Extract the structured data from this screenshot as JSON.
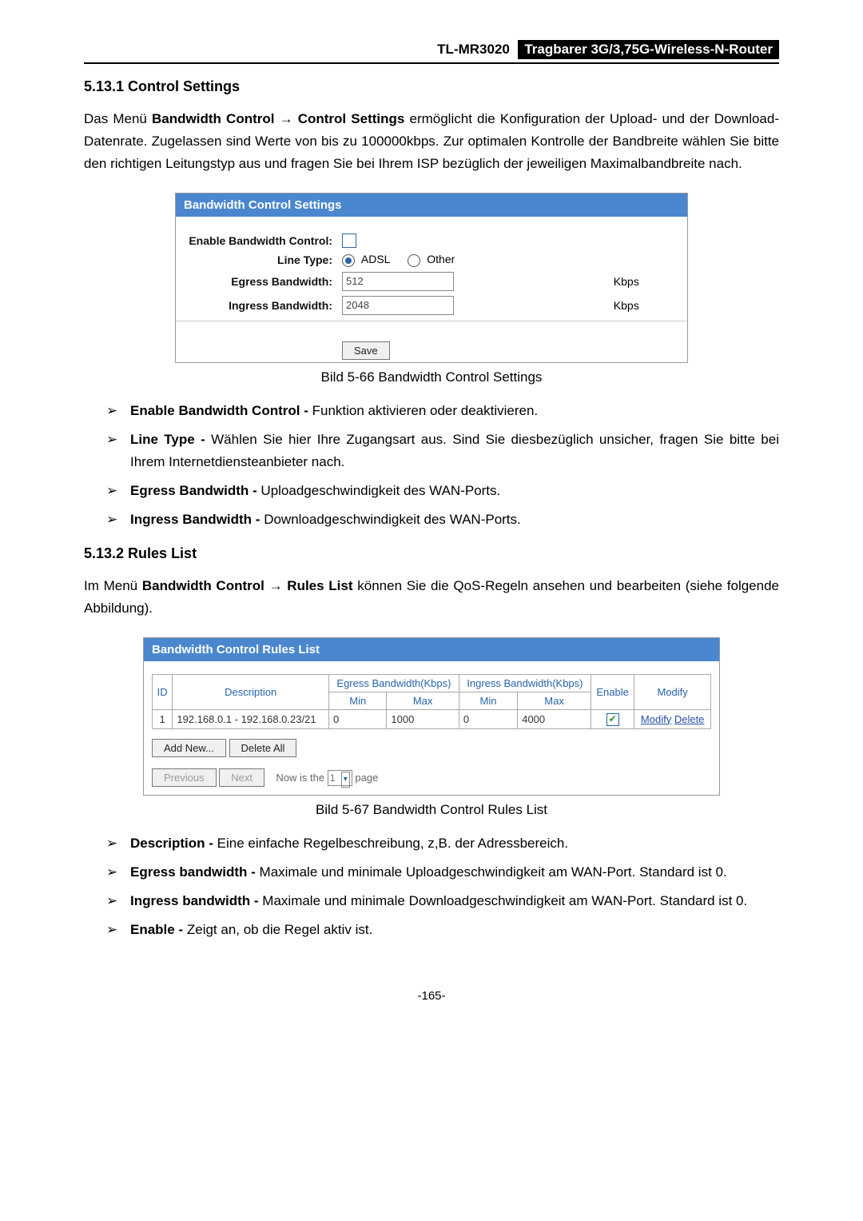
{
  "header": {
    "model": "TL-MR3020",
    "tagline": "Tragbarer 3G/3,75G-Wireless-N-Router"
  },
  "sec1": {
    "heading": "5.13.1  Control Settings",
    "para_pre": "Das Menü ",
    "para_bold": "Bandwidth Control → Control Settings",
    "para_post": " ermöglicht die Konfiguration der Upload- und der Download-Datenrate. Zugelassen sind Werte von bis zu 100000kbps. Zur optimalen Kontrolle der Bandbreite wählen Sie bitte den richtigen Leitungstyp aus und fragen Sie bei Ihrem ISP bezüglich der jeweiligen Maximalbandbreite nach."
  },
  "panel1": {
    "title": "Bandwidth Control Settings",
    "labels": {
      "enable": "Enable Bandwidth Control:",
      "line": "Line Type:",
      "egress": "Egress Bandwidth:",
      "ingress": "Ingress Bandwidth:"
    },
    "radios": {
      "adsl": "ADSL",
      "other": "Other"
    },
    "egress_val": "512",
    "ingress_val": "2048",
    "unit": "Kbps",
    "save": "Save",
    "caption": "Bild 5-66 Bandwidth Control Settings"
  },
  "list1": [
    {
      "b": "Enable Bandwidth Control - ",
      "t": "Funktion aktivieren oder deaktivieren."
    },
    {
      "b": "Line Type - ",
      "t": "Wählen Sie hier Ihre Zugangsart aus. Sind Sie diesbezüglich unsicher, fragen Sie bitte bei Ihrem Internetdiensteanbieter nach."
    },
    {
      "b": "Egress Bandwidth - ",
      "t": "Uploadgeschwindigkeit des WAN-Ports."
    },
    {
      "b": "Ingress Bandwidth - ",
      "t": "Downloadgeschwindigkeit des WAN-Ports."
    }
  ],
  "sec2": {
    "heading": "5.13.2  Rules List",
    "para_pre": "Im Menü ",
    "para_bold": "Bandwidth Control → Rules List",
    "para_post": " können Sie die QoS-Regeln ansehen und bearbeiten (siehe folgende Abbildung)."
  },
  "panel2": {
    "title": "Bandwidth Control Rules List",
    "cols": {
      "id": "ID",
      "desc": "Description",
      "egress": "Egress Bandwidth(Kbps)",
      "ingress": "Ingress Bandwidth(Kbps)",
      "min": "Min",
      "max": "Max",
      "enable": "Enable",
      "modify": "Modify"
    },
    "row": {
      "id": "1",
      "desc": "192.168.0.1 - 192.168.0.23/21",
      "emin": "0",
      "emax": "1000",
      "imin": "0",
      "imax": "4000",
      "modify": "Modify",
      "delete": "Delete"
    },
    "buttons": {
      "add": "Add New...",
      "deleteall": "Delete All",
      "prev": "Previous",
      "next": "Next",
      "nowis": "Now is the",
      "page": "page",
      "sel": "1"
    },
    "caption": "Bild 5-67 Bandwidth Control Rules List"
  },
  "list2": [
    {
      "b": "Description - ",
      "t": "Eine einfache Regelbeschreibung, z,B. der Adressbereich."
    },
    {
      "b": "Egress bandwidth - ",
      "t": "Maximale und minimale Uploadgeschwindigkeit am WAN-Port. Standard ist 0."
    },
    {
      "b": "Ingress bandwidth - ",
      "t": "Maximale und minimale Downloadgeschwindigkeit am WAN-Port. Standard ist 0."
    },
    {
      "b": "Enable - ",
      "t": "Zeigt an, ob die Regel aktiv ist."
    }
  ],
  "pagenum": "-165-"
}
